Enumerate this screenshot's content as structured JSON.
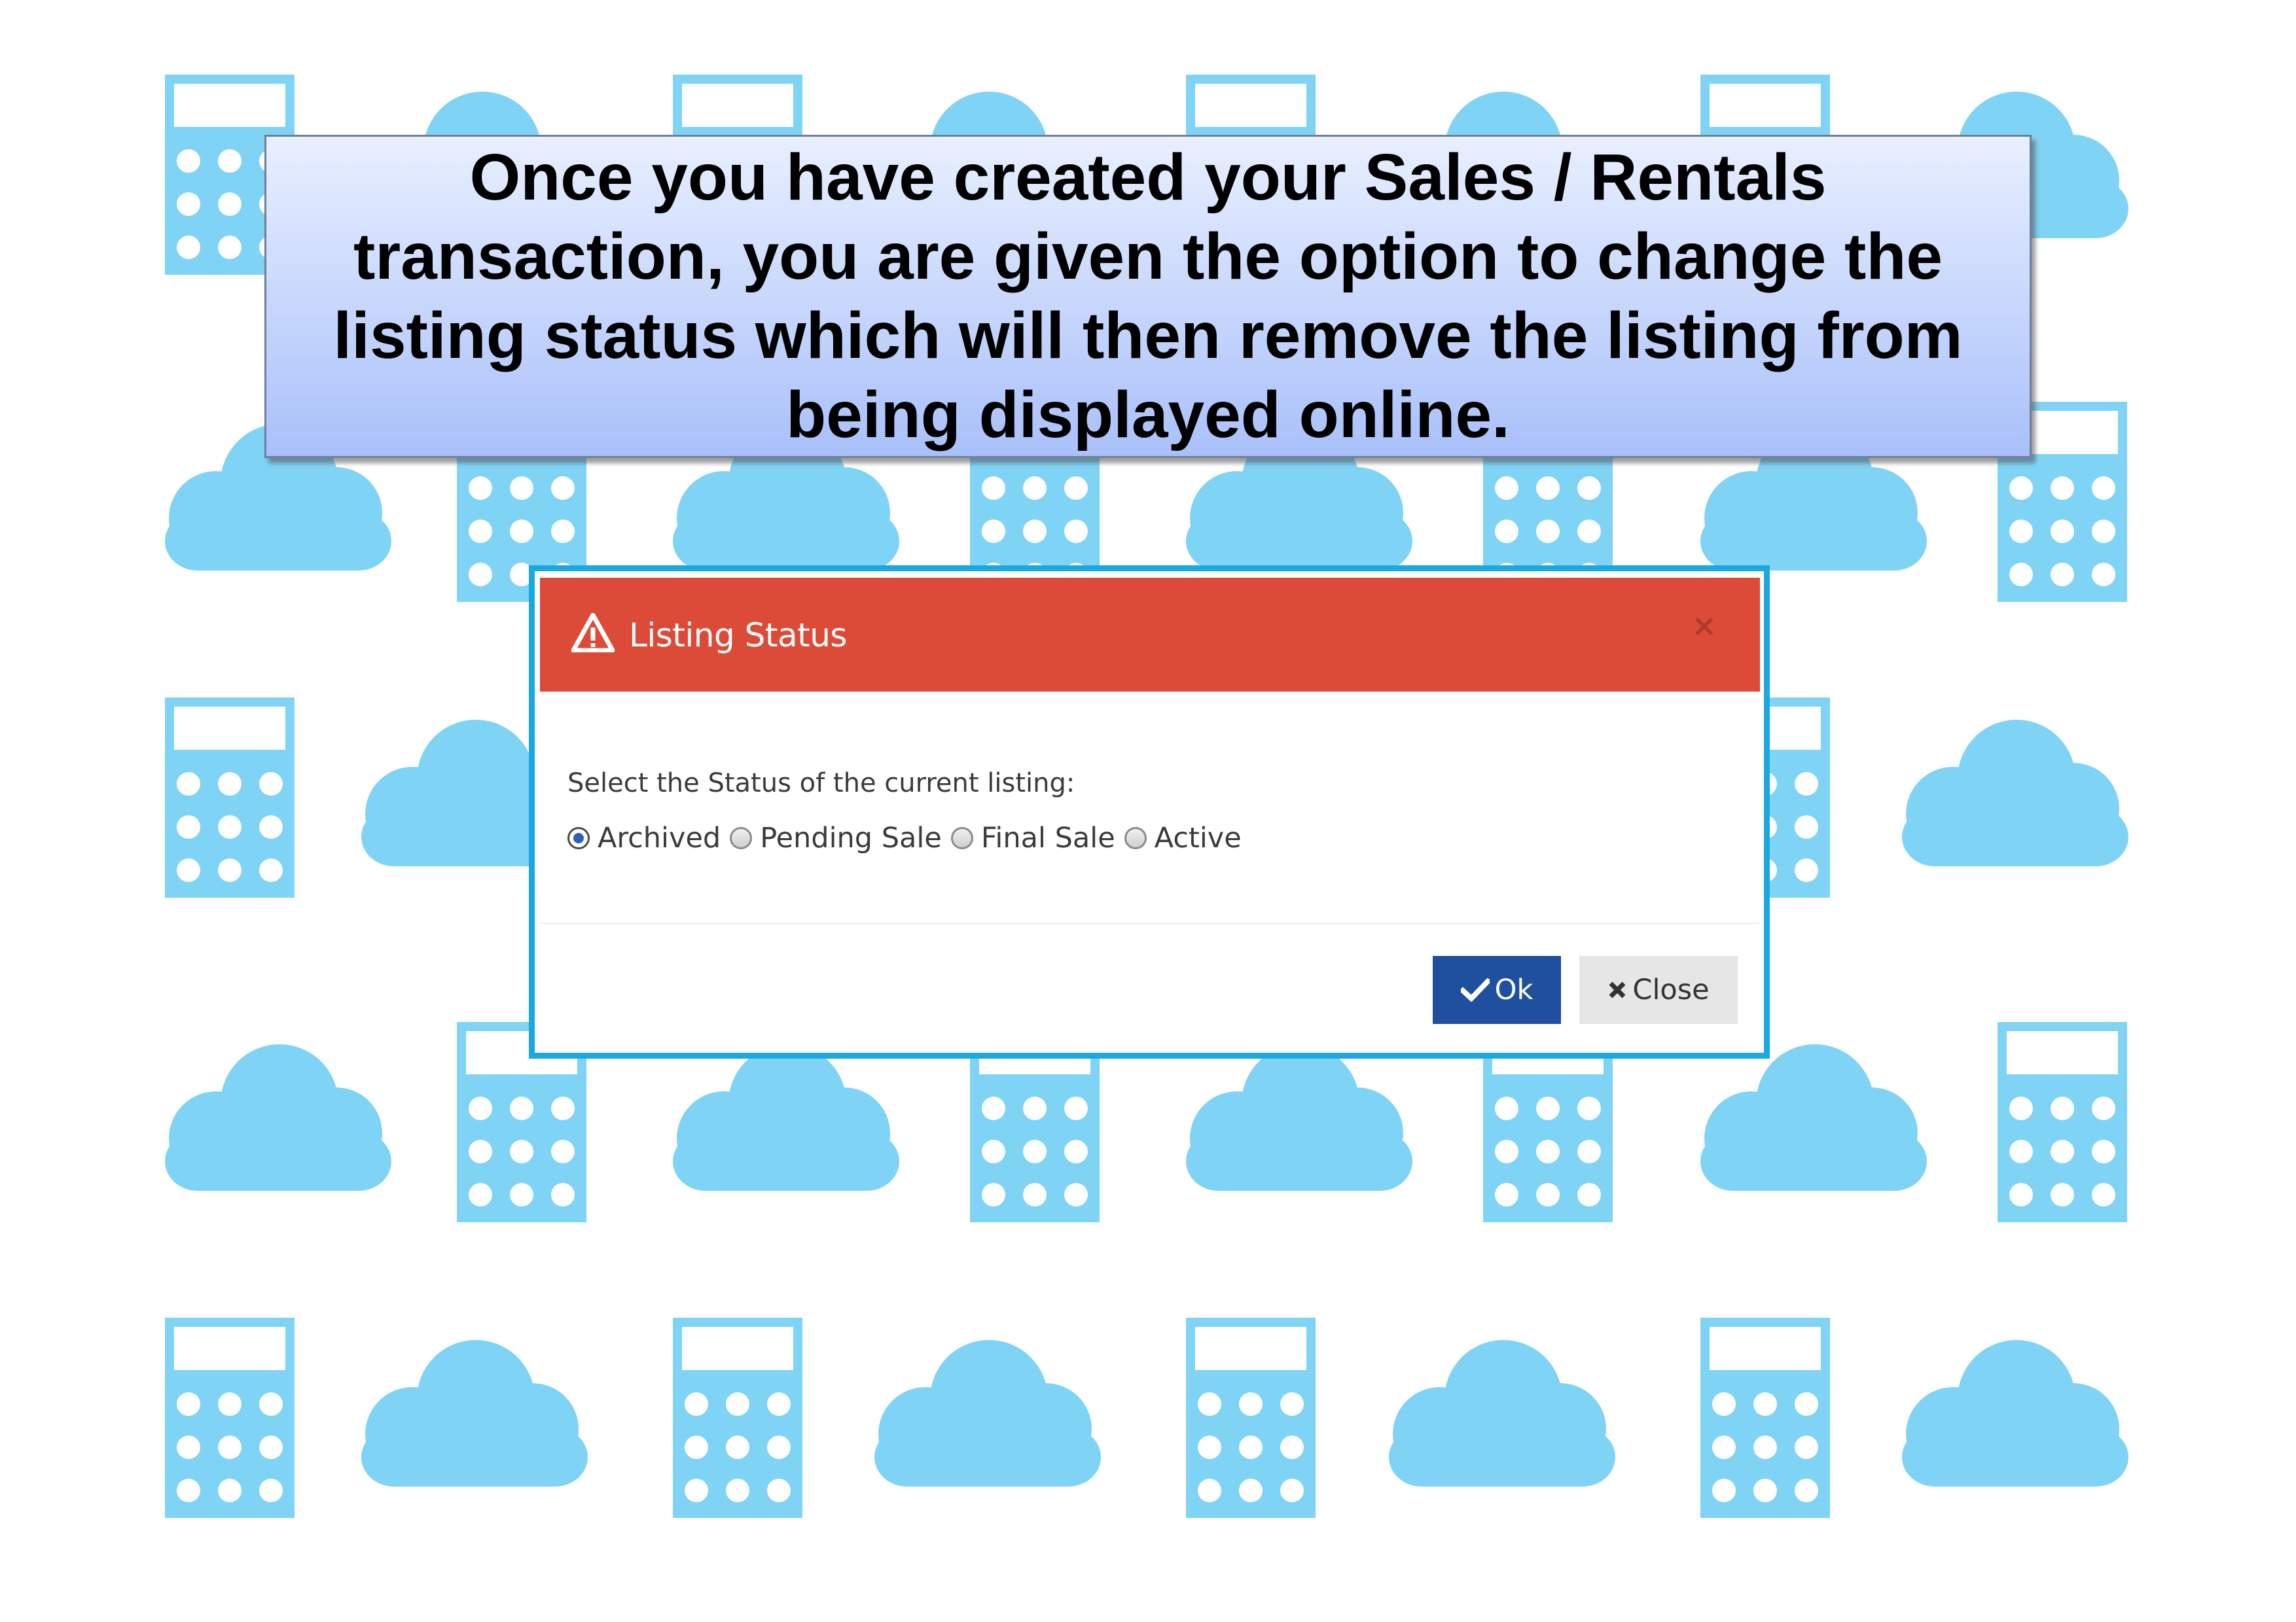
{
  "banner": {
    "text": "Once you have created your Sales / Rentals transaction, you are given the option to change the listing status which will then remove the listing from being displayed online."
  },
  "dialog": {
    "title": "Listing Status",
    "title_icon": "warning-triangle-icon",
    "close_symbol": "×",
    "prompt": "Select the Status of the current listing:",
    "options": [
      {
        "label": "Archived",
        "checked": true
      },
      {
        "label": "Pending Sale",
        "checked": false
      },
      {
        "label": "Final Sale",
        "checked": false
      },
      {
        "label": "Active",
        "checked": false
      }
    ],
    "ok_label": "Ok",
    "ok_icon": "check-icon",
    "close_label": "Close",
    "close_icon": "x-icon"
  },
  "colors": {
    "header": "#db4b38",
    "dialog_border": "#1aa8e0",
    "ok_button": "#1f4f9f",
    "close_button": "#e6e6e6",
    "pattern": "#7fd3f5",
    "banner_top": "#e8efff",
    "banner_bottom": "#a9c0fa"
  }
}
